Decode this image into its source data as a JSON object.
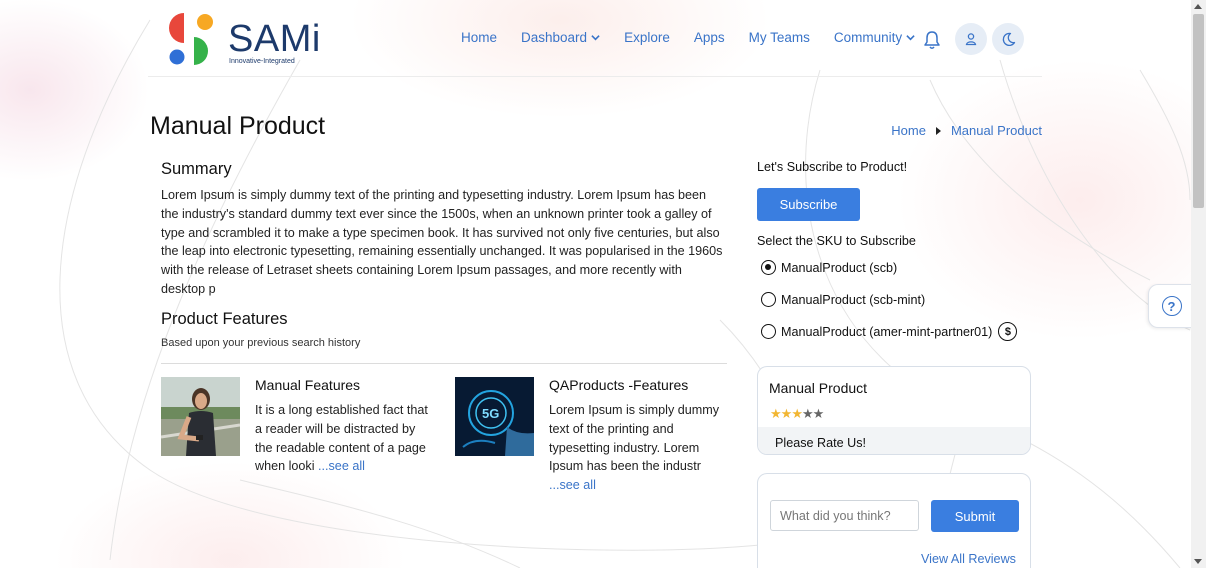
{
  "brand": {
    "name": "SAMi",
    "tagline": "Innovative-Integrated",
    "colors": {
      "red": "#e8473b",
      "orange": "#f7a823",
      "blue": "#2f6fd6",
      "green": "#35b24a",
      "navy": "#1d3a6b"
    }
  },
  "nav": {
    "items": [
      {
        "label": "Home",
        "dropdown": false
      },
      {
        "label": "Dashboard",
        "dropdown": true
      },
      {
        "label": "Explore",
        "dropdown": false
      },
      {
        "label": "Apps",
        "dropdown": false
      },
      {
        "label": "My Teams",
        "dropdown": false
      },
      {
        "label": "Community",
        "dropdown": true
      }
    ],
    "icons": [
      "bell-icon",
      "user-icon",
      "moon-icon"
    ]
  },
  "page": {
    "title": "Manual Product",
    "breadcrumb": [
      "Home",
      "Manual Product"
    ]
  },
  "summary": {
    "heading": "Summary",
    "text": "Lorem Ipsum is simply dummy text of the printing and typesetting industry. Lorem Ipsum has been the industry's standard dummy text ever since the 1500s, when an unknown printer took a galley of type and scrambled it to make a type specimen book. It has survived not only five centuries, but also the leap into electronic typesetting, remaining essentially unchanged. It was popularised in the 1960s with the release of Letraset sheets containing Lorem Ipsum passages, and more recently with desktop p"
  },
  "features": {
    "heading": "Product Features",
    "subtitle": "Based upon your previous search history",
    "cards": [
      {
        "title": "Manual Features",
        "text": "It is a long established fact that a reader will be distracted by the readable content of a page when looki",
        "more": "...see all"
      },
      {
        "title": "QAProducts -Features",
        "text": "Lorem Ipsum is simply dummy text of the printing and typesetting industry. Lorem Ipsum has been the industr",
        "more": "...see all"
      }
    ]
  },
  "subscribe": {
    "prompt": "Let's Subscribe to Product!",
    "button": "Subscribe",
    "sku_label": "Select the SKU to Subscribe",
    "skus": [
      {
        "label": "ManualProduct (scb)",
        "selected": true,
        "paid": false
      },
      {
        "label": "ManualProduct (scb-mint)",
        "selected": false,
        "paid": false
      },
      {
        "label": "ManualProduct (amer-mint-partner01)",
        "selected": false,
        "paid": true
      }
    ],
    "dollar_symbol": "$"
  },
  "rating": {
    "title": "Manual Product",
    "stars_filled": 3,
    "stars_total": 5,
    "prompt": "Please Rate Us!"
  },
  "review": {
    "placeholder": "What did you think?",
    "submit": "Submit",
    "view_all": "View All Reviews"
  },
  "help": {
    "symbol": "?"
  }
}
